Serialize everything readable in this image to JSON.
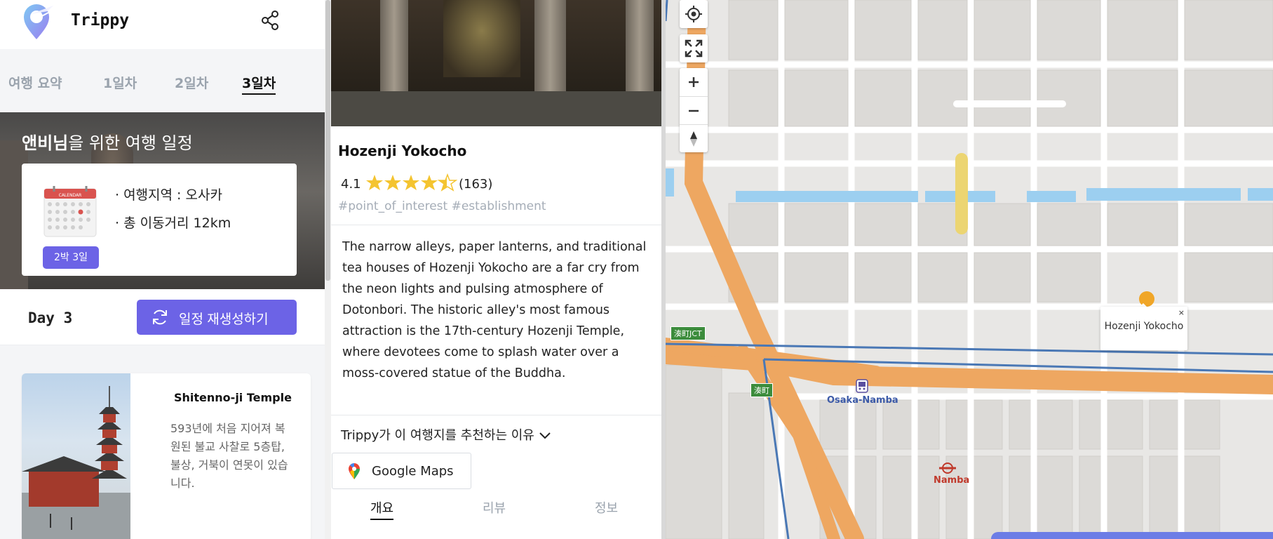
{
  "app": {
    "brand": "Trippy",
    "share_icon": "share-icon",
    "accent_color": "#6c63e6"
  },
  "tabs": [
    {
      "label": "여행 요약",
      "active": false
    },
    {
      "label": "1일차",
      "active": false
    },
    {
      "label": "2일차",
      "active": false
    },
    {
      "label": "3일차",
      "active": true
    }
  ],
  "hero": {
    "user_name": "앤비님",
    "title_rest": "을 위한 여행 일정",
    "region_line": "· 여행지역 : 오사카",
    "distance_line": "· 총 이동거리 12km",
    "duration_badge": "2박 3일",
    "calendar_label": "CALENDAR"
  },
  "day": {
    "label": "Day 3",
    "regenerate_button": "일정 재생성하기"
  },
  "itinerary": [
    {
      "name": "Shitenno-ji Temple",
      "description": "593년에 처음 지어져 복원된 불교 사찰로 5층탑, 불상, 거북이 연못이 있습니다."
    }
  ],
  "poi": {
    "title": "Hozenji Yokocho",
    "rating": "4.1",
    "rating_value": 4.1,
    "review_count": "(163)",
    "tags": "#point_of_interest #establishment",
    "description": "The narrow alleys, paper lanterns, and traditional tea houses of Hozenji Yokocho are a far cry from the neon lights and pulsing atmosphere of Dotonbori. The historic alley's most famous attraction is the 17th-century Hozenji Temple, where devotees come to splash water over a moss-covered statue of the Buddha.",
    "reason_toggle": "Trippy가 이 여행지를 추천하는 이유",
    "google_maps_button": "Google Maps",
    "subtabs": [
      {
        "label": "개요",
        "active": true
      },
      {
        "label": "리뷰",
        "active": false
      },
      {
        "label": "정보",
        "active": false
      }
    ]
  },
  "map": {
    "popup_label": "Hozenji Yokocho",
    "popup_close": "×",
    "station_osaka_namba": "Osaka-Namba",
    "station_namba": "Namba",
    "sign_jct": "湊町JCT",
    "sign_exit": "湊町",
    "controls": [
      "locate-icon",
      "fullscreen-icon",
      "zoom-in-icon",
      "zoom-out-icon",
      "compass-icon"
    ]
  }
}
